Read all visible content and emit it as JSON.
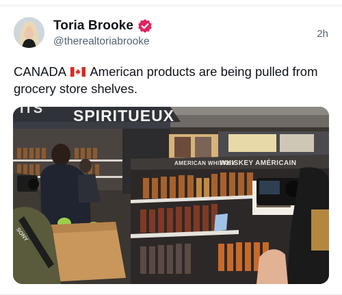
{
  "post": {
    "author_name": "Toria Brooke",
    "handle": "@therealtoriabrooke",
    "time_ago": "2h",
    "text_before_flag": "CANADA",
    "text_after_flag": " American products are being pulled from grocery store shelves."
  },
  "icons": {
    "verified": "verified-badge-icon",
    "flag": "canada-flag-icon"
  },
  "media": {
    "sign_large": "SPIRITUEUX",
    "sign_left": "ITS",
    "sign_american_en": "AMERICAN WHISKEY",
    "sign_american_fr": "WHISKEY AMÉRICAIN",
    "camera_brand": "SONY"
  },
  "colors": {
    "verified_badge": "#e0245e",
    "text_primary": "#0f1419",
    "text_secondary": "#536471"
  }
}
